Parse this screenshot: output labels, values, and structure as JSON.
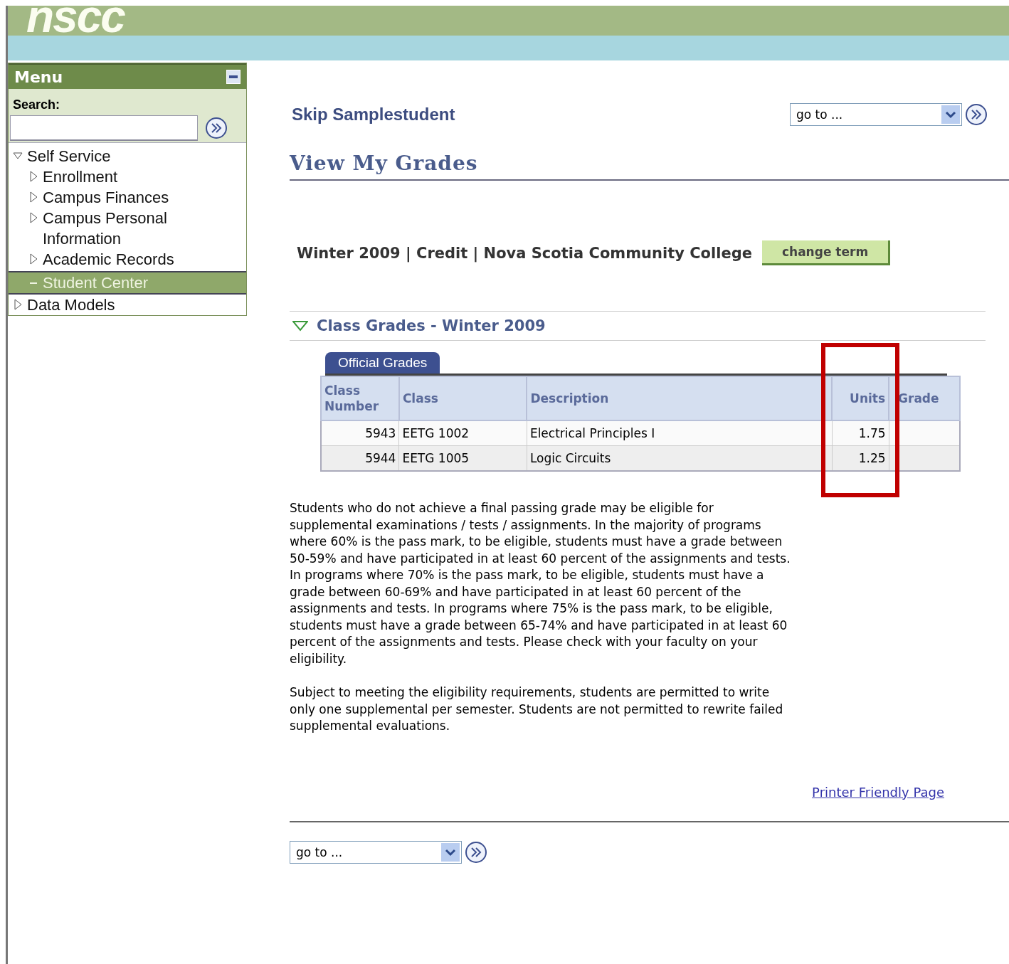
{
  "header": {
    "logo": "nscc"
  },
  "menu": {
    "title": "Menu",
    "search_label": "Search:",
    "items": [
      {
        "label": "Self Service",
        "expanded": true,
        "selected": false,
        "children": [
          {
            "label": "Enrollment",
            "expanded": false,
            "selected": false
          },
          {
            "label": "Campus Finances",
            "expanded": false,
            "selected": false
          },
          {
            "label": "Campus Personal Information",
            "expanded": false,
            "selected": false
          },
          {
            "label": "Academic Records",
            "expanded": false,
            "selected": false
          },
          {
            "label": "Student Center",
            "kind": "leaf",
            "selected": true
          }
        ]
      },
      {
        "label": "Data Models",
        "expanded": false,
        "selected": false
      }
    ]
  },
  "student_name": "Skip Samplestudent",
  "goto_top": {
    "value": "go to ..."
  },
  "page_title": "View My Grades",
  "term": "Winter 2009 | Credit | Nova Scotia Community College",
  "change_term_button": "change term",
  "section": {
    "title": "Class Grades - Winter 2009",
    "expanded": true
  },
  "tabs": [
    {
      "label": "Official Grades",
      "selected": true
    }
  ],
  "table": {
    "columns": [
      {
        "label": "Class Number",
        "kind": "numeric",
        "highlighted": false
      },
      {
        "label": "Class",
        "kind": "text",
        "highlighted": false
      },
      {
        "label": "Description",
        "kind": "text",
        "highlighted": false
      },
      {
        "label": "Units",
        "kind": "numeric",
        "highlighted": true
      },
      {
        "label": "Grade",
        "kind": "text",
        "highlighted": false
      }
    ],
    "rows": [
      [
        "5943",
        "EETG 1002",
        "Electrical Principles I",
        "1.75",
        ""
      ],
      [
        "5944",
        "EETG 1005",
        "Logic Circuits",
        "1.25",
        ""
      ]
    ]
  },
  "notes": [
    "Students who do not achieve a final passing grade may be eligible for supplemental examinations / tests / assignments. In the majority of programs where 60% is the pass mark, to be eligible, students must have a grade between 50-59% and have participated in at least 60 percent of the assignments and tests. In programs where 70% is the pass mark, to be eligible, students must have a grade between 60-69% and have participated in at least 60 percent of the assignments and tests. In programs where 75% is the pass mark, to be eligible, students must have a grade between 65-74% and have participated in at least 60 percent of the assignments and tests. Please check with your faculty on your eligibility.",
    "Subject to meeting the eligibility requirements, students are permitted to write only one supplemental per semester. Students are not permitted to rewrite failed supplemental evaluations."
  ],
  "printer_link": "Printer Friendly Page",
  "goto_bottom": {
    "value": "go to ..."
  }
}
